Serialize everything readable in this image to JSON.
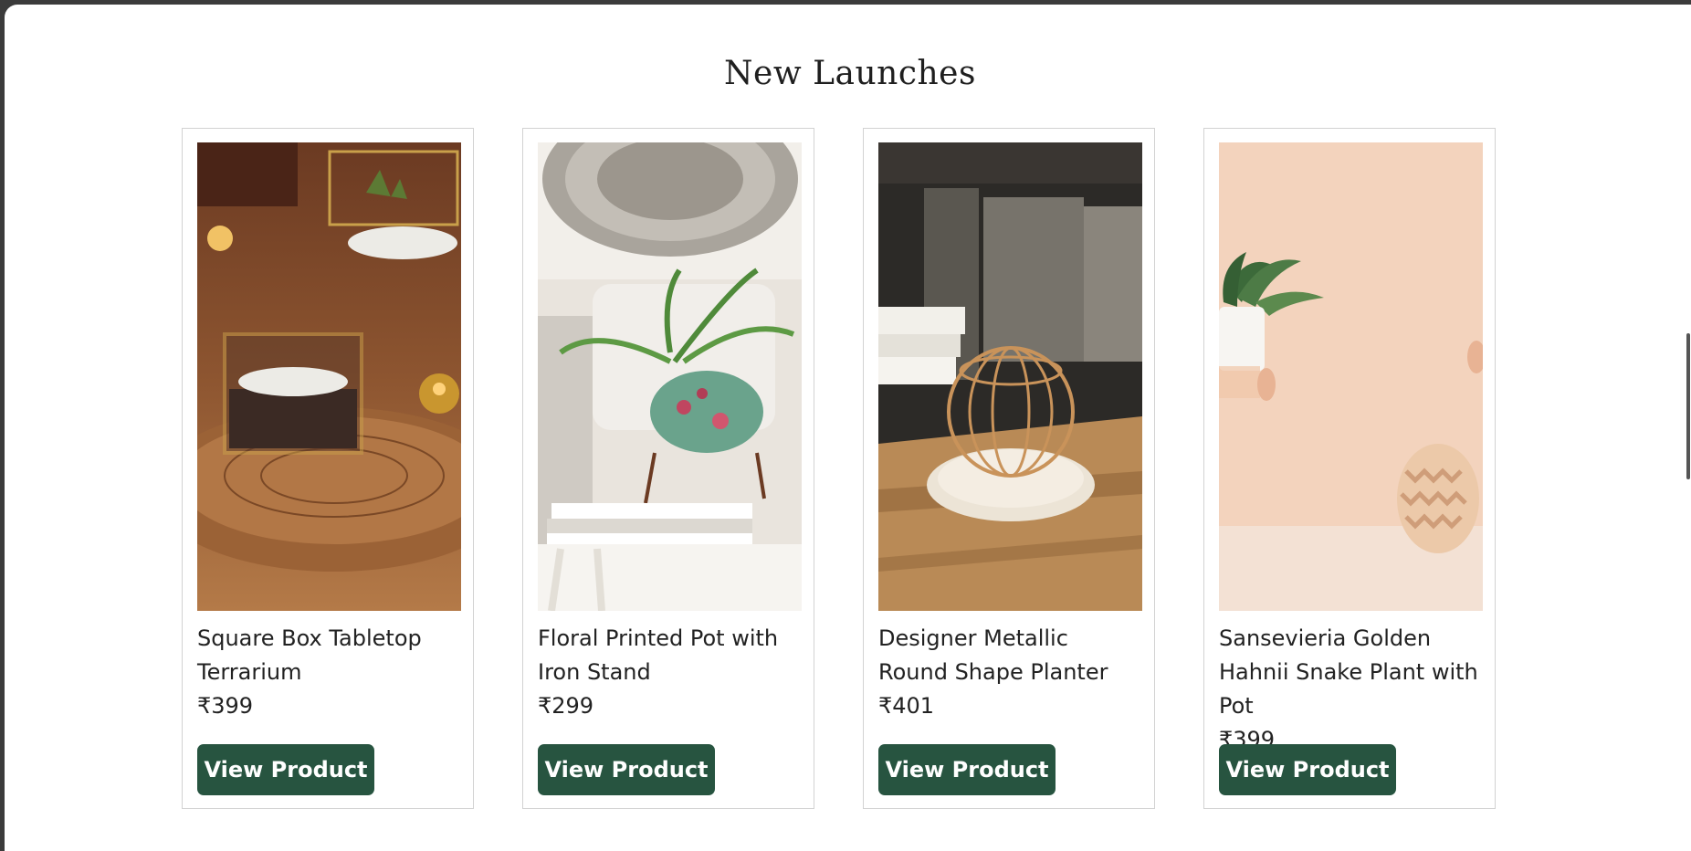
{
  "section": {
    "title": "New Launches"
  },
  "products": [
    {
      "name": "Square Box Tabletop Terrarium",
      "price": "₹399",
      "button": "View Product"
    },
    {
      "name": "Floral Printed Pot with Iron Stand",
      "price": "₹299",
      "button": "View Product"
    },
    {
      "name": "Designer Metallic Round Shape Planter",
      "price": "₹401",
      "button": "View Product"
    },
    {
      "name": "Sansevieria Golden Hahnii Snake Plant with Pot",
      "price": "₹399",
      "button": "View Product"
    }
  ],
  "colors": {
    "button_bg": "#275440",
    "button_text": "#ffffff",
    "card_border": "#d2d2d2"
  }
}
